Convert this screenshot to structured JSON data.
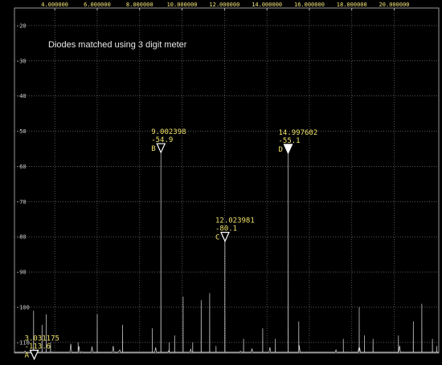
{
  "chart_data": {
    "type": "line",
    "note": "Diodes matched using 3 digit meter",
    "x_ticks": [
      "4.000000",
      "6.000000",
      "8.000000",
      "10.000000",
      "12.000000",
      "14.000000",
      "16.000000",
      "18.000000",
      "20.000000"
    ],
    "y_ticks": [
      "-20",
      "-30",
      "-40",
      "-50",
      "-60",
      "-70",
      "-80",
      "-90",
      "-100",
      "-110"
    ],
    "xlim": [
      2.1,
      22.1
    ],
    "ylim": [
      -113,
      -15
    ],
    "markers": [
      {
        "id": "A",
        "freq": "3.031175",
        "level": "-113.6",
        "x": 3.031175,
        "y": -113.6,
        "filled": false
      },
      {
        "id": "B",
        "freq": "9.002398",
        "level": "-54.9",
        "x": 9.002398,
        "y": -54.9,
        "filled": false
      },
      {
        "id": "C",
        "freq": "12.023981",
        "level": "-80.1",
        "x": 12.023981,
        "y": -80.1,
        "filled": false
      },
      {
        "id": "D",
        "freq": "14.997602",
        "level": "-55.1",
        "x": 14.997602,
        "y": -55.1,
        "filled": true
      }
    ],
    "spurs": [
      {
        "x": 3.0,
        "y": -101
      },
      {
        "x": 3.4,
        "y": -105
      },
      {
        "x": 3.6,
        "y": -102
      },
      {
        "x": 3.8,
        "y": -110
      },
      {
        "x": 5.1,
        "y": -110
      },
      {
        "x": 6.0,
        "y": -102
      },
      {
        "x": 7.2,
        "y": -105
      },
      {
        "x": 8.6,
        "y": -106
      },
      {
        "x": 9.0,
        "y": -54.9
      },
      {
        "x": 9.0,
        "y": -85
      },
      {
        "x": 9.4,
        "y": -110
      },
      {
        "x": 9.65,
        "y": -108
      },
      {
        "x": 10.05,
        "y": -97
      },
      {
        "x": 10.5,
        "y": -110
      },
      {
        "x": 10.9,
        "y": -98
      },
      {
        "x": 11.3,
        "y": -96
      },
      {
        "x": 11.6,
        "y": -111
      },
      {
        "x": 12.02,
        "y": -80.1
      },
      {
        "x": 12.02,
        "y": -100
      },
      {
        "x": 12.9,
        "y": -109
      },
      {
        "x": 13.8,
        "y": -106
      },
      {
        "x": 14.4,
        "y": -109
      },
      {
        "x": 15.0,
        "y": -55.1
      },
      {
        "x": 15.0,
        "y": -86
      },
      {
        "x": 15.5,
        "y": -104
      },
      {
        "x": 17.6,
        "y": -109
      },
      {
        "x": 18.35,
        "y": -100
      },
      {
        "x": 18.6,
        "y": -108
      },
      {
        "x": 19.0,
        "y": -109
      },
      {
        "x": 20.2,
        "y": -108
      },
      {
        "x": 20.9,
        "y": -104
      },
      {
        "x": 21.3,
        "y": -99
      },
      {
        "x": 21.8,
        "y": -109
      },
      {
        "x": 22.0,
        "y": -111
      }
    ],
    "noise_floor": -117
  }
}
